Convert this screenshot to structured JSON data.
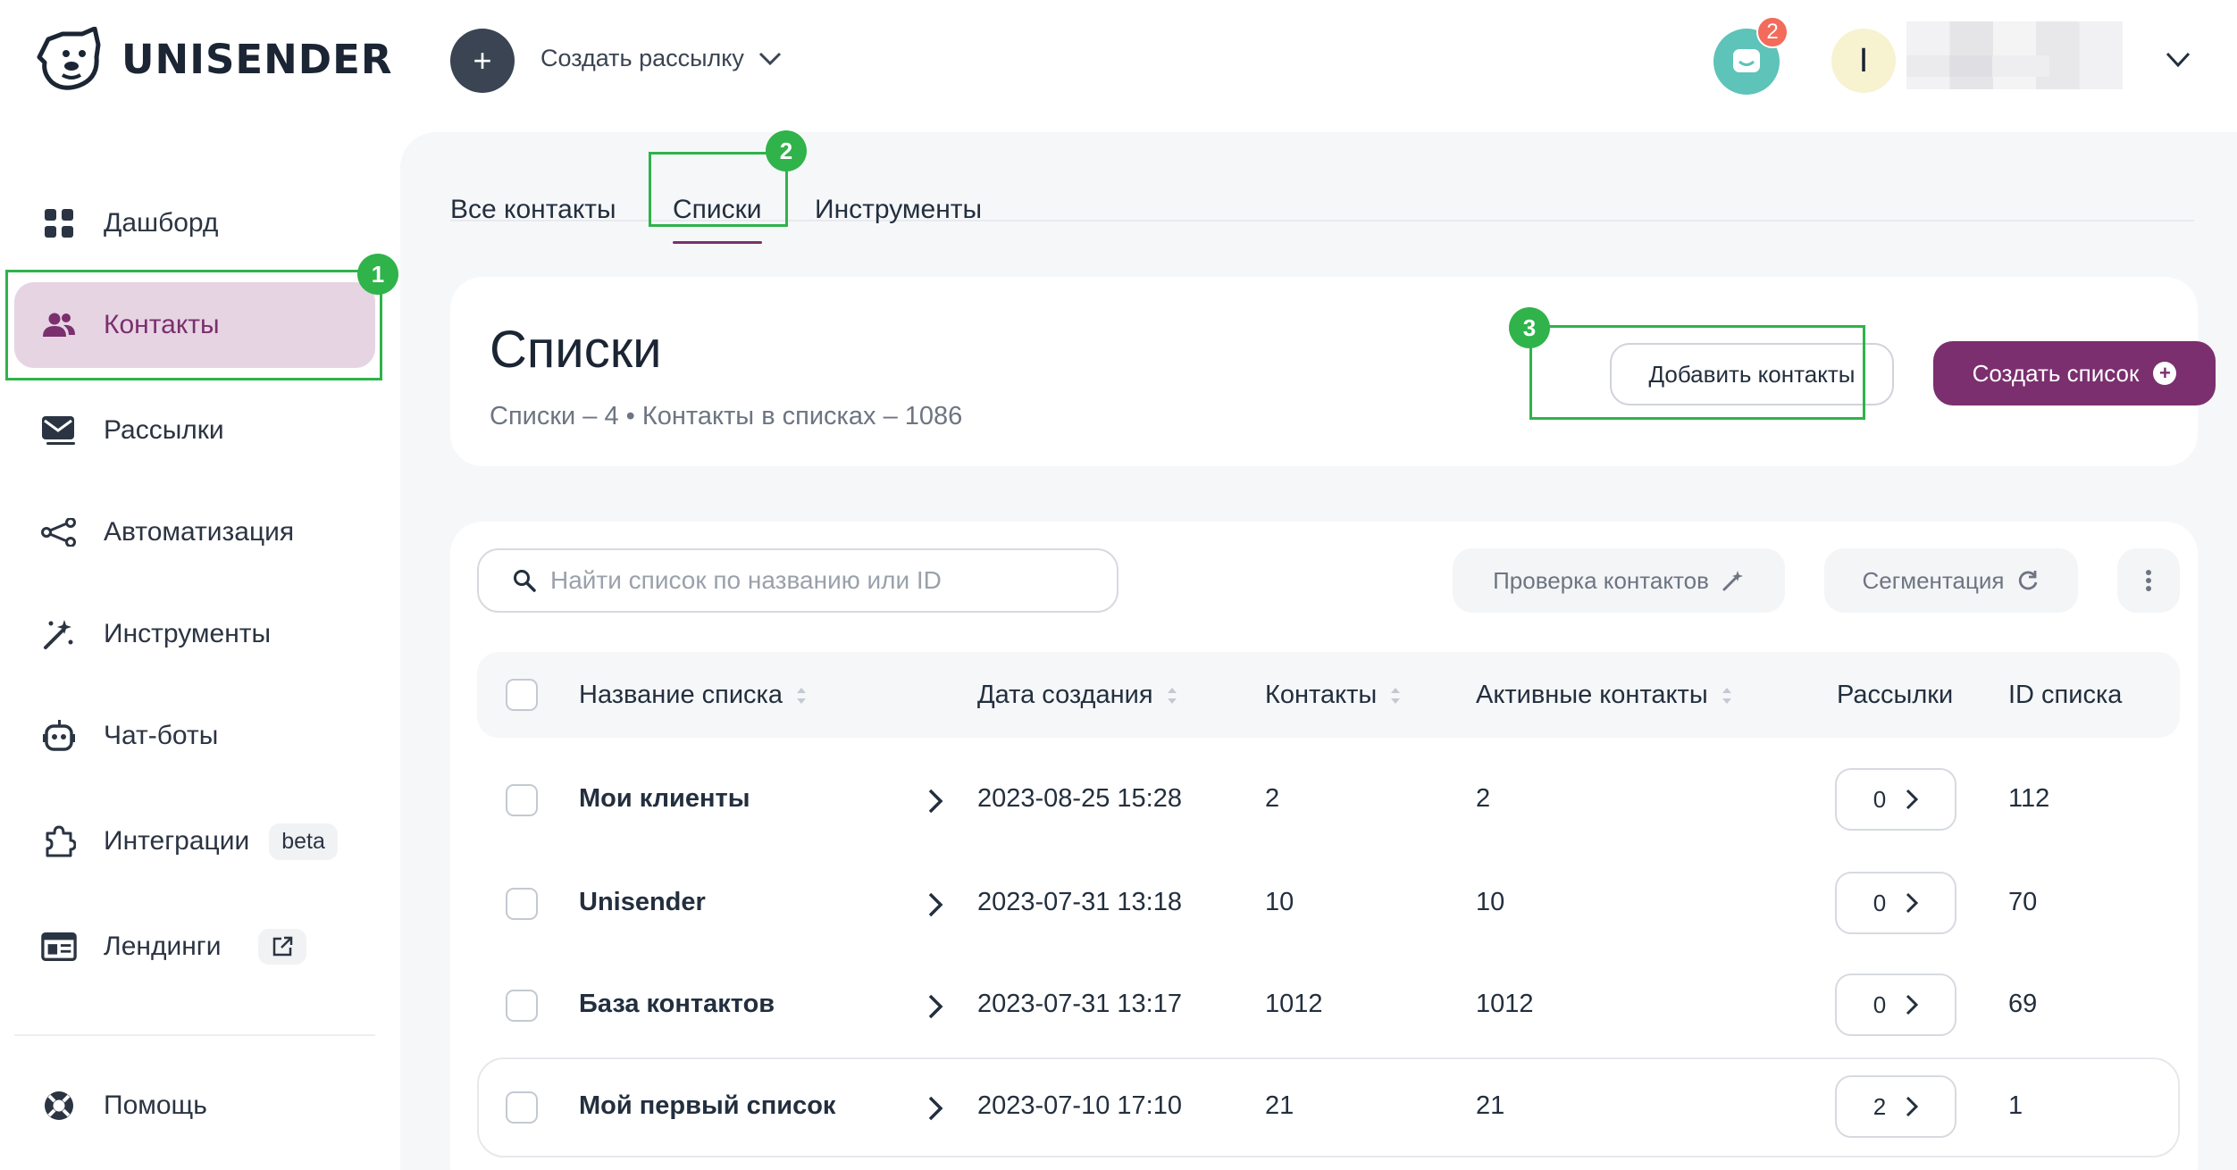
{
  "app": {
    "brand": "UNISENDER"
  },
  "topbar": {
    "create_label": "Создать рассылку",
    "chat_badge": "2",
    "avatar_letter": "I"
  },
  "sidebar": {
    "items": [
      {
        "label": "Дашборд",
        "icon": "grid-icon"
      },
      {
        "label": "Контакты",
        "icon": "users-icon",
        "active": true
      },
      {
        "label": "Рассылки",
        "icon": "envelope-icon"
      },
      {
        "label": "Автоматизация",
        "icon": "flow-icon"
      },
      {
        "label": "Инструменты",
        "icon": "magic-wand-icon"
      },
      {
        "label": "Чат-боты",
        "icon": "robot-icon"
      },
      {
        "label": "Интеграции",
        "icon": "puzzle-icon",
        "tag": "beta"
      },
      {
        "label": "Лендинги",
        "icon": "landing-icon"
      },
      {
        "label": "Помощь",
        "icon": "lifebuoy-icon"
      }
    ]
  },
  "tabs": [
    "Все контакты",
    "Списки",
    "Инструменты"
  ],
  "header": {
    "title": "Списки",
    "subtitle": "Списки – 4 • Контакты в списках – 1086",
    "add_contacts": "Добавить контакты",
    "create_list": "Создать список"
  },
  "toolbar": {
    "search_placeholder": "Найти список по названию или ID",
    "check_contacts": "Проверка контактов",
    "segmentation": "Сегментация"
  },
  "table": {
    "columns": [
      "Название списка",
      "Дата создания",
      "Контакты",
      "Активные контакты",
      "Рассылки",
      "ID списка"
    ],
    "rows": [
      {
        "name": "Мои клиенты",
        "created": "2023-08-25 15:28",
        "contacts": "2",
        "active": "2",
        "mailings": "0",
        "id": "112"
      },
      {
        "name": "Unisender",
        "created": "2023-07-31 13:18",
        "contacts": "10",
        "active": "10",
        "mailings": "0",
        "id": "70"
      },
      {
        "name": "База контактов",
        "created": "2023-07-31 13:17",
        "contacts": "1012",
        "active": "1012",
        "mailings": "0",
        "id": "69"
      },
      {
        "name": "Мой первый список",
        "created": "2023-07-10 17:10",
        "contacts": "21",
        "active": "21",
        "mailings": "2",
        "id": "1"
      }
    ]
  },
  "annotations": [
    "1",
    "2",
    "3"
  ],
  "colors": {
    "accent": "#7b2f6e",
    "active_nav": "#e6d4e3",
    "highlight": "#2fb34a",
    "chat": "#5ec3b8",
    "badge": "#f26b5b"
  }
}
